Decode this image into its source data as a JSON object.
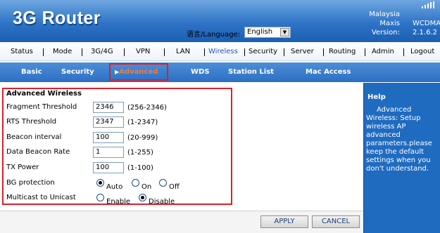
{
  "header": {
    "logo": "3G Router",
    "language_label": "语言/Language:",
    "language_value": "English",
    "country": "Malaysia",
    "operator": "Maxis",
    "network": "WCDMA",
    "version_label": "Version:",
    "version_value": "2.1.6.2"
  },
  "menu": {
    "items": [
      "Status",
      "Mode",
      "3G/4G",
      "VPN",
      "LAN",
      "Wireless",
      "Security",
      "Server",
      "Routing",
      "Admin",
      "Logout"
    ],
    "active": "Wireless"
  },
  "submenu": {
    "items": [
      "Basic",
      "Security",
      "Advanced",
      "WDS",
      "Station List",
      "Mac Access"
    ],
    "active": "Advanced"
  },
  "form": {
    "title": "Advanced Wireless",
    "fragment_label": "Fragment Threshold",
    "fragment_value": "2346",
    "fragment_hint": "(256-2346)",
    "rts_label": "RTS Threshold",
    "rts_value": "2347",
    "rts_hint": "(1-2347)",
    "beacon_label": "Beacon interval",
    "beacon_value": "100",
    "beacon_hint": "(20-999)",
    "dtim_label": "Data Beacon Rate",
    "dtim_value": "1",
    "dtim_hint": "(1-255)",
    "txpower_label": "TX Power",
    "txpower_value": "100",
    "txpower_hint": "(1-100)",
    "bg_label": "BG protection",
    "bg_options": [
      "Auto",
      "On",
      "Off"
    ],
    "bg_selected": "Auto",
    "multicast_label": "Multicast to Unicast",
    "multicast_options": [
      "Enable",
      "Disable"
    ],
    "multicast_selected": "Disable"
  },
  "buttons": {
    "apply": "APPLY",
    "cancel": "CANCEL"
  },
  "help": {
    "title": "Help",
    "text": "Advanced Wireless: Setup wireless AP advanced parameters.please keep the default settings when you don't understand."
  }
}
